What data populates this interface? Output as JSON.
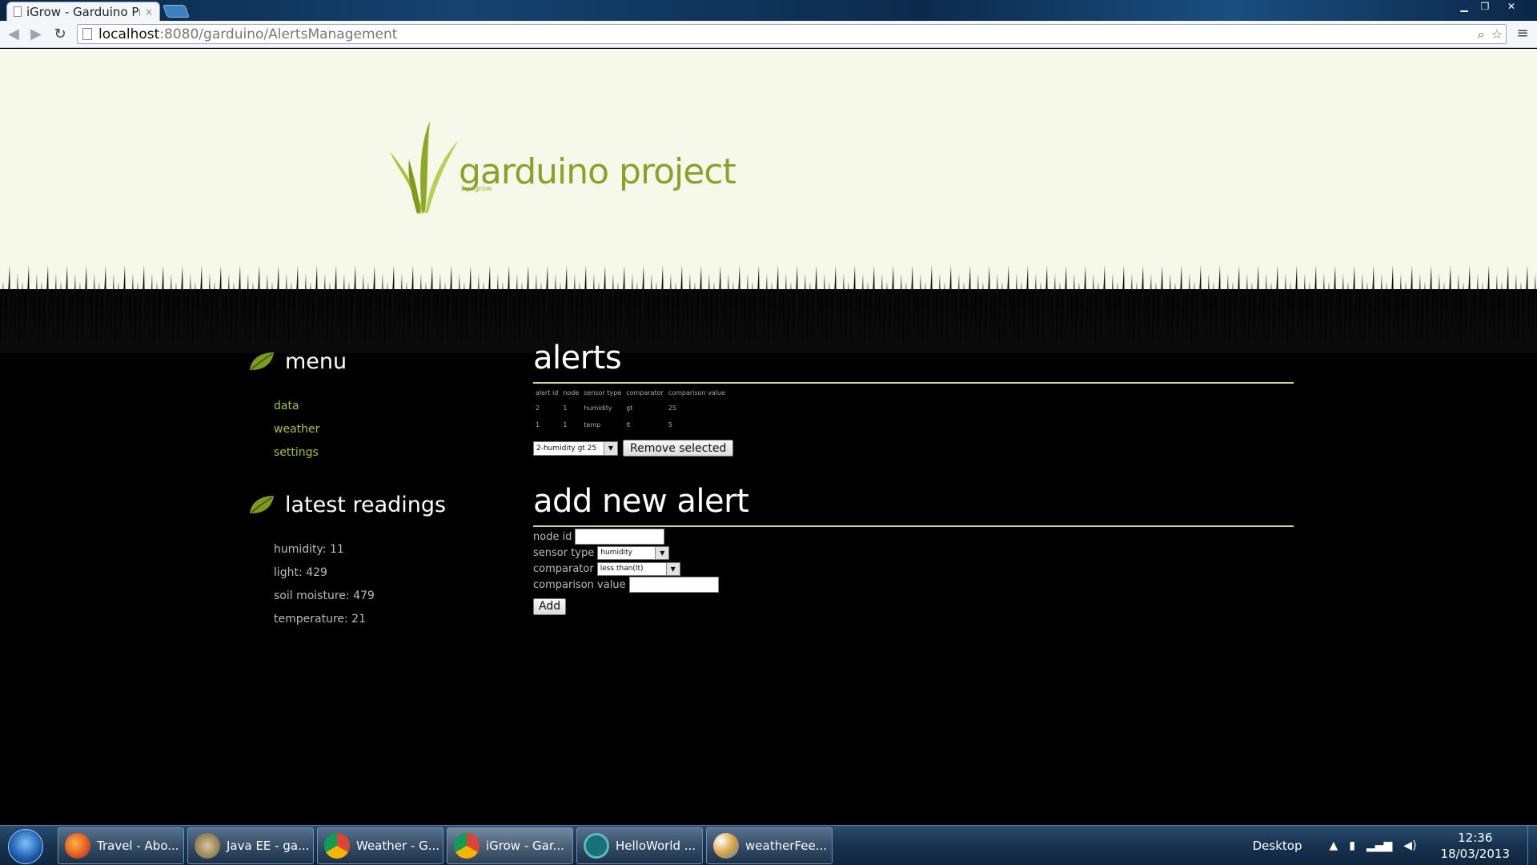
{
  "browser": {
    "tab_title": "iGrow - Garduino Pr",
    "tab_close": "×",
    "url_host": "localhost",
    "url_rest": ":8080/garduino/AlertsManagement"
  },
  "site": {
    "logo_text": "garduino project",
    "logo_sub": "by igrow"
  },
  "sidebar": {
    "menu_heading": "menu",
    "menu_items": [
      "data",
      "weather",
      "settings"
    ],
    "readings_heading": "latest readings",
    "readings": [
      "humidity: 11",
      "light: 429",
      "soil moisture: 479",
      "temperature: 21"
    ]
  },
  "alerts": {
    "heading": "alerts",
    "columns": [
      "alert id",
      "node",
      "sensor type",
      "comparator",
      "comparison value"
    ],
    "rows": [
      [
        "2",
        "1",
        "humidity",
        "gt",
        "25"
      ],
      [
        "1",
        "1",
        "temp",
        "lt",
        "5"
      ]
    ],
    "remove_select_value": "2-humidity gt 25",
    "remove_button": "Remove selected"
  },
  "add_alert": {
    "heading": "add new alert",
    "node_id_label": "node id",
    "sensor_type_label": "sensor type",
    "sensor_type_value": "humidity",
    "comparator_label": "comparator",
    "comparator_value": "less than(lt)",
    "comparison_value_label": "comparison value",
    "add_button": "Add"
  },
  "taskbar": {
    "items": [
      "Travel - Abo...",
      "Java EE - ga...",
      "Weather - G...",
      "iGrow - Gar...",
      "HelloWorld ...",
      "weatherFee..."
    ],
    "desktop_label": "Desktop",
    "time": "12:36",
    "date": "18/03/2013"
  },
  "colors": {
    "accent_green": "#a7c23a",
    "header_bg": "#f6f8ea",
    "page_bg": "#000000"
  }
}
